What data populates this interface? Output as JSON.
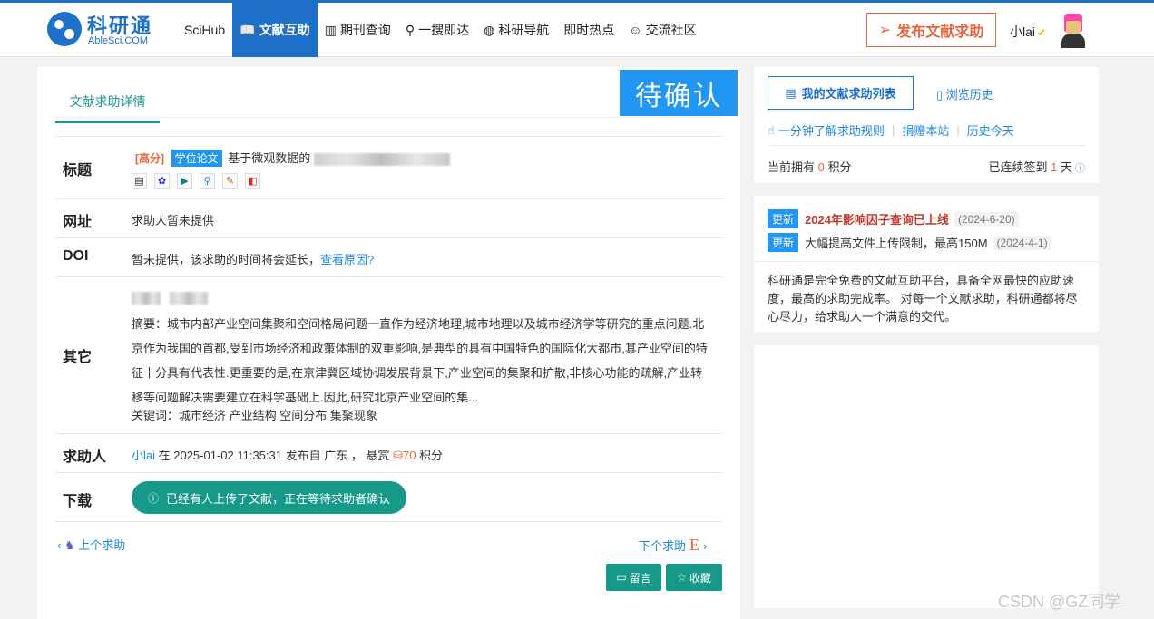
{
  "header": {
    "logo_cn": "科研通",
    "logo_en": "AbleSci.COM",
    "nav": [
      {
        "label": "SciHub",
        "icon": ""
      },
      {
        "label": "文献互助",
        "icon": "book-open-icon",
        "active": true
      },
      {
        "label": "期刊查询",
        "icon": "journal-icon"
      },
      {
        "label": "一搜即达",
        "icon": "search-icon"
      },
      {
        "label": "科研导航",
        "icon": "globe-icon"
      },
      {
        "label": "即时热点",
        "icon": ""
      },
      {
        "label": "交流社区",
        "icon": "chat-icon"
      }
    ],
    "publish_label": "发布文献求助",
    "user_name": "小lai"
  },
  "main": {
    "tab_label": "文献求助详情",
    "status": "待确认",
    "rows": {
      "title_label": "标题",
      "tag_high": "[高分]",
      "tag_type": "学位论文",
      "title_text": "基于微观数据的",
      "url_label": "网址",
      "url_value": "求助人暂未提供",
      "doi_label": "DOI",
      "doi_value": "暂未提供，该求助的时间将会延长，",
      "doi_link": "查看原因?",
      "other_label": "其它",
      "abstract": "摘要：城市内部产业空间集聚和空间格局问题一直作为经济地理,城市地理以及城市经济学等研究的重点问题.北京作为我国的首都,受到市场经济和政策体制的双重影响,是典型的具有中国特色的国际化大都市,其产业空间的特征十分具有代表性.更重要的是,在京津冀区域协调发展背景下,产业空间的集聚和扩散,非核心功能的疏解,产业转移等问题解决需要建立在科学基础上.因此,研究北京产业空间的集...",
      "keywords": "关键词：城市经济 产业结构 空间分布 集聚现象",
      "requester_label": "求助人",
      "requester_name": "小lai",
      "requester_text": " 在 2025-01-02 11:35:31 发布自 广东 ， 悬赏 ",
      "reward": "70",
      "reward_unit": " 积分",
      "download_label": "下载",
      "download_btn": "已经有人上传了文献，正在等待求助者确认"
    },
    "prev_label": "上个求助",
    "next_label": "下个求助",
    "msg_btn": "留言",
    "fav_btn": "收藏"
  },
  "sidebar": {
    "my_list": "我的文献求助列表",
    "history": "浏览历史",
    "quick_links": [
      "一分钟了解求助规则",
      "捐赠本站",
      "历史今天"
    ],
    "points_prefix": "当前拥有 ",
    "points_value": "0",
    "points_suffix": " 积分",
    "signed_prefix": "已连续签到 ",
    "signed_value": "1",
    "signed_suffix": " 天",
    "updates": [
      {
        "badge": "更新",
        "title": "2024年影响因子查询已上线",
        "date": "(2024-6-20)"
      },
      {
        "badge": "更新",
        "title": "大幅提高文件上传限制，最高150M",
        "date": "(2024-4-1)"
      }
    ],
    "intro": "科研通是完全免费的文献互助平台，具备全网最快的应助速度，最高的求助完成率。 对每一个文献求助，科研通都将尽心尽力，给求助人一个满意的交代。"
  },
  "watermark": "CSDN @GZ同学",
  "colors": {
    "brand": "#1e6fc8",
    "accent": "#17998a",
    "status": "#2196f3",
    "orange": "#e8663c"
  }
}
